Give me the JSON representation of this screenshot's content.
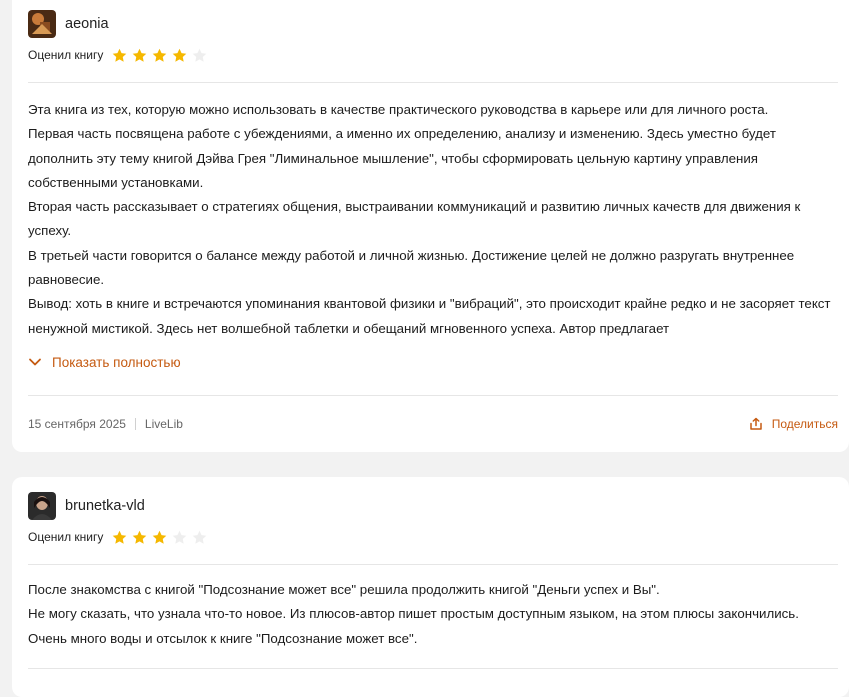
{
  "reviews": [
    {
      "username": "aeonia",
      "rating_label": "Оценил книгу",
      "rating": 4,
      "rating_max": 5,
      "paragraphs": [
        "Эта книга из тех, которую можно использовать в качестве практического руководства в карьере или для личного роста.",
        "Первая часть посвящена работе с убеждениями, а именно их определению, анализу и изменению. Здесь уместно будет дополнить эту тему книгой Дэйва Грея \"Лиминальное мышление\", чтобы сформировать цельную картину управления собственными установками.",
        "Вторая часть рассказывает о стратегиях общения, выстраивании коммуникаций и развитию личных качеств для движения к успеху.",
        "В третьей части говорится о балансе между работой и личной жизнью. Достижение целей не должно разругать внутреннее равновесие.",
        "Вывод: хоть в книге и встречаются упоминания квантовой физики и \"вибраций\", это происходит крайне редко и не засоряет текст ненужной мистикой. Здесь нет волшебной таблетки и обещаний мгновенного успеха. Автор предлагает"
      ],
      "show_more": "Показать полностью",
      "date": "15 сентября 2025",
      "source": "LiveLib",
      "share": "Поделиться"
    },
    {
      "username": "brunetka-vld",
      "rating_label": "Оценил книгу",
      "rating": 3,
      "rating_max": 5,
      "paragraphs": [
        "После знакомства с книгой \"Подсознание может все\" решила продолжить книгой \"Деньги успех и Вы\".",
        "Не могу сказать, что узнала что-то новое. Из плюсов-автор пишет простым доступным языком, на этом плюсы закончились. Очень много воды и отсылок к книге \"Подсознание может все\"."
      ]
    }
  ],
  "colors": {
    "accent": "#c55a11",
    "star_filled": "#f5b800",
    "star_empty": "#eeeeee"
  }
}
